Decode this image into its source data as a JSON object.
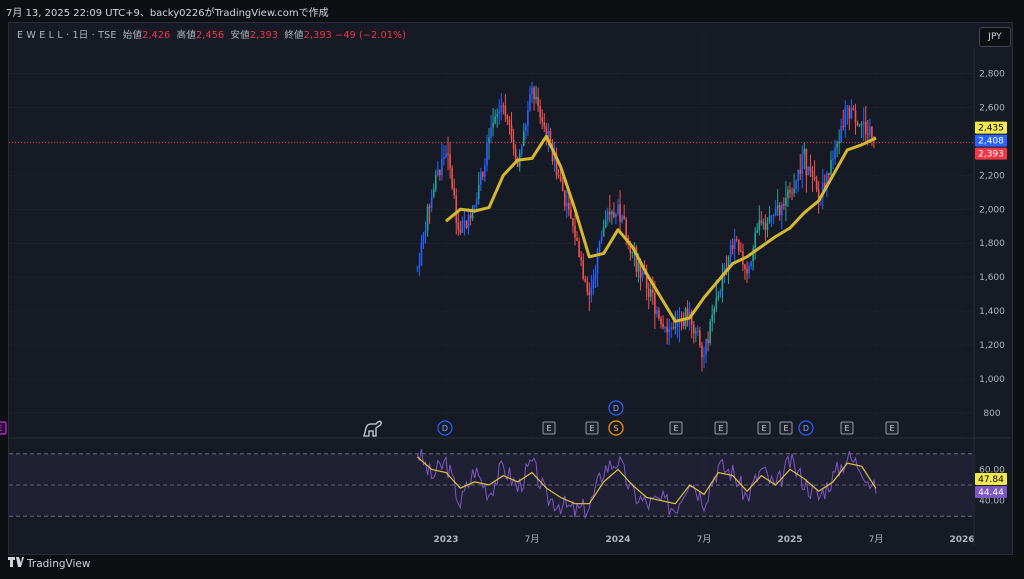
{
  "header": {
    "caption": "7月 13, 2025 22:09 UTC+9、backy0226がTradingView.comで作成"
  },
  "legend": {
    "symbol": "E W E L L · 1日 · TSE",
    "open_label": "始値",
    "open": "2,426",
    "high_label": "高値",
    "high": "2,456",
    "low_label": "安値",
    "low": "2,393",
    "close_label": "終値",
    "close": "2,393",
    "change": "−49 (−2.01%)"
  },
  "currency_button": "JPY",
  "footer": {
    "brand": "TradingView",
    "logo": "tradingview-logo-icon"
  },
  "colors": {
    "up": "#26a69a",
    "down": "#ef5350",
    "blue": "#2962ff",
    "ma": "#d4b830",
    "rsi": "#7e57c2",
    "rsi_ma": "#e0c53c",
    "price_line": "#f23645"
  },
  "chart_data": [
    {
      "type": "line",
      "title": "",
      "y_ticks": [
        "2,800",
        "2,600",
        "2,400",
        "2,200",
        "2,000",
        "1,800",
        "1,600",
        "1,400",
        "1,200",
        "1,000",
        "800"
      ],
      "ylim": [
        700,
        2950
      ],
      "x_ticks": [
        "2023",
        "7月",
        "2024",
        "7月",
        "2025",
        "7月",
        "2026"
      ],
      "price_tags": [
        {
          "value": "2,435",
          "num": 2435,
          "color": "#f5e94a",
          "text_color": "#000000"
        },
        {
          "value": "2,408",
          "num": 2408,
          "color": "#2962ff",
          "text_color": "#ffffff"
        },
        {
          "value": "2,393",
          "num": 2393,
          "color": "#f23645",
          "text_color": "#ffffff"
        }
      ],
      "series": [
        {
          "kind": "price",
          "x": [
            "2022-11",
            "2022-12",
            "2023-01",
            "2023-02",
            "2023-03",
            "2023-04",
            "2023-05",
            "2023-06",
            "2023-07",
            "2023-08",
            "2023-09",
            "2023-10",
            "2023-11",
            "2023-12",
            "2024-01",
            "2024-02",
            "2024-03",
            "2024-04",
            "2024-05",
            "2024-06",
            "2024-07",
            "2024-08",
            "2024-09",
            "2024-10",
            "2024-11",
            "2024-12",
            "2025-01",
            "2025-02",
            "2025-03",
            "2025-04",
            "2025-05",
            "2025-06",
            "2025-07"
          ],
          "values": [
            1650,
            2100,
            2350,
            1850,
            2050,
            2400,
            2650,
            2250,
            2700,
            2450,
            2150,
            1850,
            1500,
            1900,
            2000,
            1750,
            1550,
            1350,
            1280,
            1400,
            1150,
            1500,
            1800,
            1650,
            1950,
            1950,
            2100,
            2300,
            2050,
            2300,
            2600,
            2500,
            2420
          ]
        },
        {
          "kind": "moving-average",
          "x": [
            "2023-01",
            "2023-02",
            "2023-03",
            "2023-04",
            "2023-05",
            "2023-06",
            "2023-07",
            "2023-08",
            "2023-09",
            "2023-10",
            "2023-11",
            "2023-12",
            "2024-01",
            "2024-02",
            "2024-03",
            "2024-04",
            "2024-05",
            "2024-06",
            "2024-07",
            "2024-08",
            "2024-09",
            "2024-10",
            "2024-11",
            "2024-12",
            "2025-01",
            "2025-02",
            "2025-03",
            "2025-04",
            "2025-05",
            "2025-06",
            "2025-07"
          ],
          "values": [
            1930,
            2000,
            1990,
            2010,
            2200,
            2290,
            2300,
            2430,
            2250,
            2000,
            1720,
            1740,
            1880,
            1780,
            1620,
            1480,
            1340,
            1360,
            1480,
            1580,
            1680,
            1720,
            1780,
            1840,
            1890,
            1980,
            2050,
            2200,
            2350,
            2380,
            2420
          ]
        }
      ]
    },
    {
      "type": "line",
      "title": "",
      "y_ticks": [
        "60.00",
        "40.00"
      ],
      "rsi_tags": [
        {
          "value": "47.84",
          "num": 47.84,
          "color": "#f5e94a",
          "text_color": "#000000"
        },
        {
          "value": "44.44",
          "num": 44.44,
          "color": "#7e57c2",
          "text_color": "#ffffff"
        }
      ],
      "bands": [
        70,
        50,
        30
      ],
      "ylim": [
        25,
        75
      ],
      "series": [
        {
          "kind": "rsi",
          "x": [
            "2022-11",
            "2022-12",
            "2023-01",
            "2023-02",
            "2023-03",
            "2023-04",
            "2023-05",
            "2023-06",
            "2023-07",
            "2023-08",
            "2023-09",
            "2023-10",
            "2023-11",
            "2023-12",
            "2024-01",
            "2024-02",
            "2024-03",
            "2024-04",
            "2024-05",
            "2024-06",
            "2024-07",
            "2024-08",
            "2024-09",
            "2024-10",
            "2024-11",
            "2024-12",
            "2025-01",
            "2025-02",
            "2025-03",
            "2025-04",
            "2025-05",
            "2025-06",
            "2025-07"
          ],
          "values": [
            72,
            55,
            65,
            38,
            60,
            45,
            62,
            48,
            64,
            42,
            38,
            33,
            36,
            60,
            66,
            45,
            38,
            40,
            35,
            55,
            40,
            62,
            58,
            42,
            60,
            48,
            65,
            52,
            42,
            55,
            68,
            62,
            44.44
          ]
        },
        {
          "kind": "rsi-ma",
          "x": [
            "2022-11",
            "2022-12",
            "2023-01",
            "2023-02",
            "2023-03",
            "2023-04",
            "2023-05",
            "2023-06",
            "2023-07",
            "2023-08",
            "2023-09",
            "2023-10",
            "2023-11",
            "2023-12",
            "2024-01",
            "2024-02",
            "2024-03",
            "2024-04",
            "2024-05",
            "2024-06",
            "2024-07",
            "2024-08",
            "2024-09",
            "2024-10",
            "2024-11",
            "2024-12",
            "2025-01",
            "2025-02",
            "2025-03",
            "2025-04",
            "2025-05",
            "2025-06",
            "2025-07"
          ],
          "values": [
            68,
            60,
            58,
            48,
            52,
            50,
            56,
            52,
            58,
            48,
            42,
            38,
            38,
            52,
            60,
            50,
            42,
            40,
            38,
            50,
            44,
            58,
            56,
            46,
            56,
            50,
            60,
            54,
            46,
            52,
            64,
            62,
            47.84
          ]
        }
      ]
    }
  ],
  "events": [
    {
      "label": "",
      "icon": "dinosaur-icon"
    },
    {
      "label": "D",
      "kind": "dividend"
    },
    {
      "label": "E",
      "kind": "earnings"
    },
    {
      "label": "E",
      "kind": "earnings"
    },
    {
      "label": "S",
      "kind": "split"
    },
    {
      "label": "D",
      "kind": "dividend"
    },
    {
      "label": "E",
      "kind": "earnings"
    },
    {
      "label": "E",
      "kind": "earnings"
    },
    {
      "label": "E",
      "kind": "earnings"
    },
    {
      "label": "E",
      "kind": "earnings"
    },
    {
      "label": "D",
      "kind": "dividend"
    },
    {
      "label": "E",
      "kind": "earnings"
    },
    {
      "label": "E",
      "kind": "earnings"
    },
    {
      "label": "E",
      "kind": "earnings-upcoming"
    }
  ]
}
